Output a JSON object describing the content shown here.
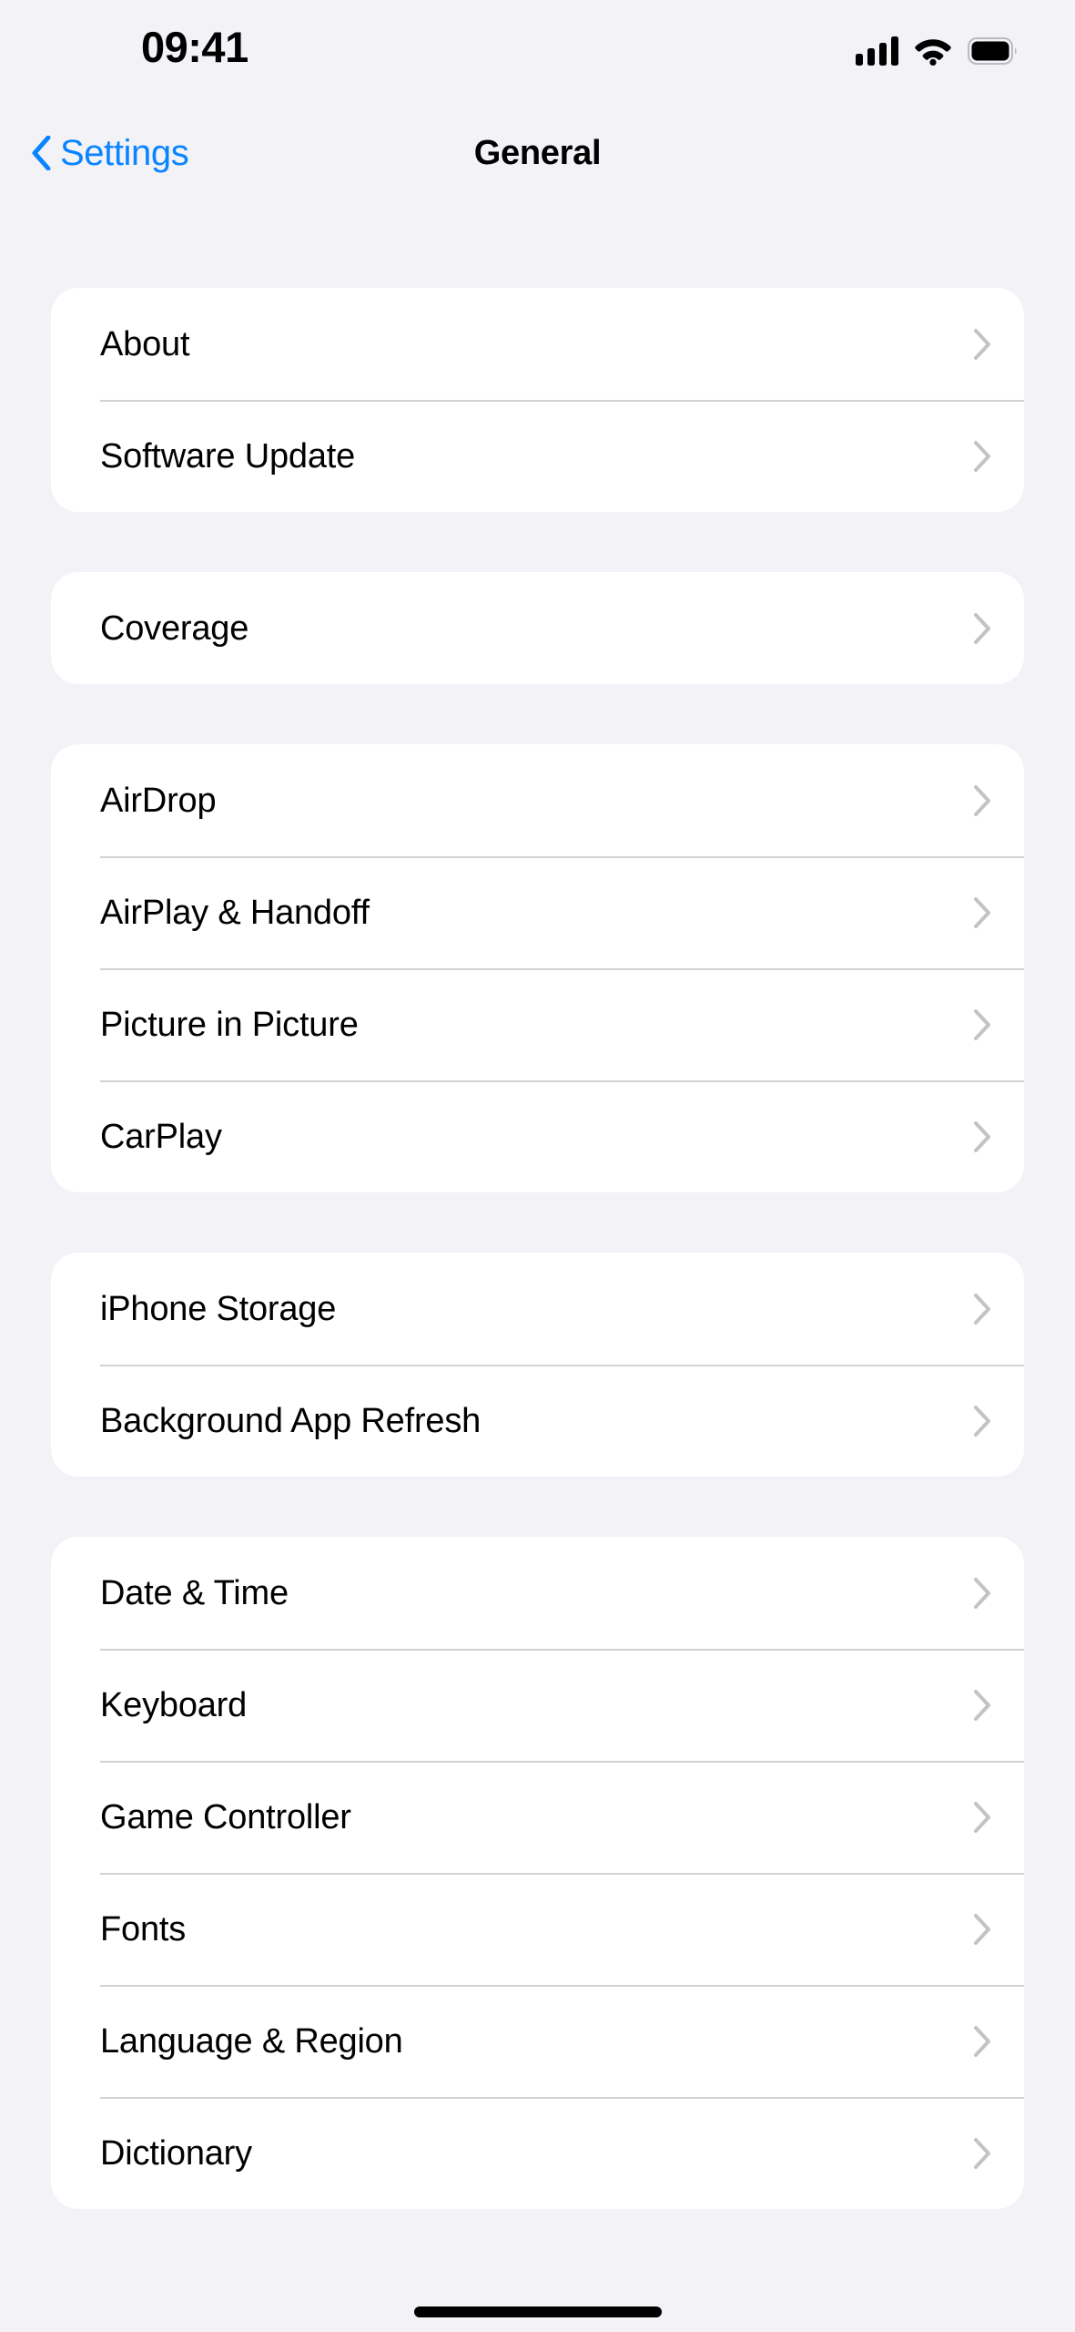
{
  "status_bar": {
    "time": "09:41",
    "icons": [
      "cellular-signal-icon",
      "wifi-icon",
      "battery-icon"
    ],
    "battery_full": true,
    "signal_bars": 4
  },
  "nav_bar": {
    "back_label": "Settings",
    "back_icon": "chevron-left-icon",
    "title": "General"
  },
  "theme": {
    "background": "#F2F2F7",
    "card_background": "#FFFFFF",
    "accent_blue": "#0A84FF",
    "label_color": "#000000",
    "separator": "#D2D2D6",
    "chevron_color": "#C3C3C7"
  },
  "groups": [
    {
      "rows": [
        {
          "label": "About",
          "accessory": "chevron-right-icon"
        },
        {
          "label": "Software Update",
          "accessory": "chevron-right-icon"
        }
      ]
    },
    {
      "rows": [
        {
          "label": "Coverage",
          "accessory": "chevron-right-icon"
        }
      ]
    },
    {
      "rows": [
        {
          "label": "AirDrop",
          "accessory": "chevron-right-icon"
        },
        {
          "label": "AirPlay & Handoff",
          "accessory": "chevron-right-icon"
        },
        {
          "label": "Picture in Picture",
          "accessory": "chevron-right-icon"
        },
        {
          "label": "CarPlay",
          "accessory": "chevron-right-icon"
        }
      ]
    },
    {
      "rows": [
        {
          "label": "iPhone Storage",
          "accessory": "chevron-right-icon"
        },
        {
          "label": "Background App Refresh",
          "accessory": "chevron-right-icon"
        }
      ]
    },
    {
      "rows": [
        {
          "label": "Date & Time",
          "accessory": "chevron-right-icon"
        },
        {
          "label": "Keyboard",
          "accessory": "chevron-right-icon"
        },
        {
          "label": "Game Controller",
          "accessory": "chevron-right-icon"
        },
        {
          "label": "Fonts",
          "accessory": "chevron-right-icon"
        },
        {
          "label": "Language & Region",
          "accessory": "chevron-right-icon"
        },
        {
          "label": "Dictionary",
          "accessory": "chevron-right-icon"
        }
      ]
    }
  ],
  "home_indicator": "home-indicator"
}
